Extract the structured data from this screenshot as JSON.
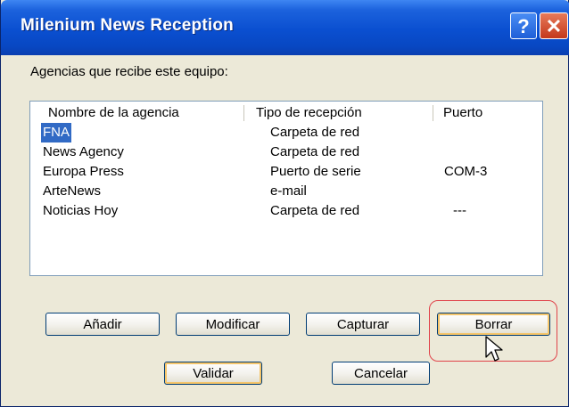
{
  "window": {
    "title": "Milenium News Reception"
  },
  "titlebar": {
    "help_glyph": "?",
    "close_glyph": "✕"
  },
  "caption": "Agencias que recibe este equipo:",
  "list": {
    "columns": [
      "Nombre de la agencia",
      "Tipo de recepción",
      "Puerto"
    ],
    "rows": [
      {
        "name": "FNA",
        "type": "Carpeta de red",
        "port": "",
        "selected": true
      },
      {
        "name": "News Agency",
        "type": "Carpeta de red",
        "port": ""
      },
      {
        "name": "Europa Press",
        "type": "Puerto de serie",
        "port": "COM-3"
      },
      {
        "name": "ArteNews",
        "type": "e-mail",
        "port": ""
      },
      {
        "name": "Noticias Hoy",
        "type": "Carpeta de red",
        "port": "---"
      }
    ]
  },
  "buttons": {
    "add": "Añadir",
    "modify": "Modificar",
    "capture": "Capturar",
    "delete": "Borrar",
    "validate": "Validar",
    "cancel": "Cancelar"
  },
  "colors": {
    "titlebar": "#0a4fd0",
    "selection": "#316ac5",
    "highlight": "#e0434a"
  }
}
